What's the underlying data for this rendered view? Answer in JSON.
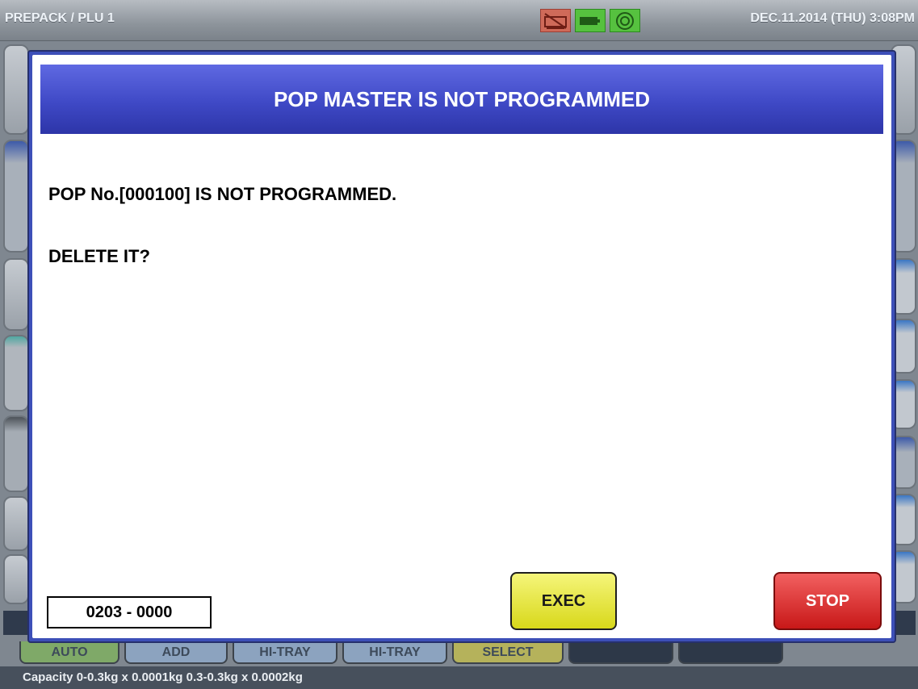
{
  "topbar": {
    "title": "PREPACK / PLU 1",
    "datetime": "DEC.11.2014 (THU)   3:08PM",
    "icons": [
      "printer-warning-icon",
      "battery-icon",
      "network-icon"
    ]
  },
  "background": {
    "tabs": [
      "AUTO",
      "ADD",
      "HI-TRAY",
      "HI-TRAY",
      "SELECT",
      "",
      ""
    ]
  },
  "dialog": {
    "title": "POP MASTER IS NOT PROGRAMMED",
    "message_line1": "POP No.[000100] IS NOT PROGRAMMED.",
    "message_line2": "DELETE IT?",
    "code": "0203 - 0000",
    "exec_label": "EXEC",
    "stop_label": "STOP"
  },
  "footer": {
    "capacity": "Capacity 0-0.3kg x 0.0001kg  0.3-0.3kg x 0.0002kg"
  },
  "colors": {
    "header_blue": "#3f49c6",
    "exec_yellow": "#e6e63a",
    "stop_red": "#dc2a2a"
  }
}
